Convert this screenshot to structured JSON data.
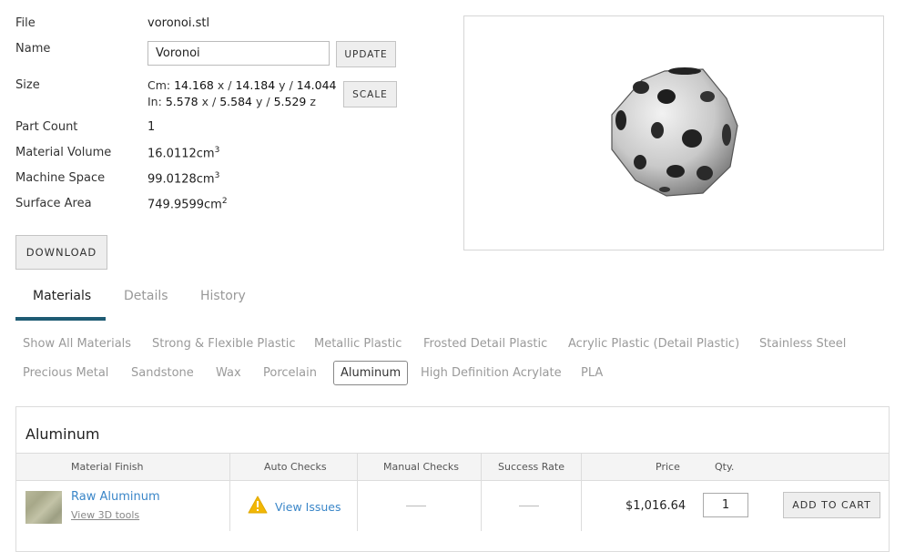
{
  "file": {
    "label": "File",
    "value": "voronoi.stl"
  },
  "name": {
    "label": "Name",
    "value": "Voronoi",
    "update_label": "UPDATE"
  },
  "size": {
    "label": "Size",
    "cm_prefix": "Cm:",
    "cm_x": "14.168",
    "cm_y": "14.184",
    "cm_z": "14.044",
    "in_prefix": "In:",
    "in_x": "5.578",
    "in_y": "5.584",
    "in_z": "5.529",
    "x_unit": "x",
    "y_unit": "y",
    "z_unit": "z",
    "sep": "/",
    "scale_label": "SCALE"
  },
  "part_count": {
    "label": "Part Count",
    "value": "1"
  },
  "material_volume": {
    "label": "Material Volume",
    "value": "16.0112cm",
    "exp": "3"
  },
  "machine_space": {
    "label": "Machine Space",
    "value": "99.0128cm",
    "exp": "3"
  },
  "surface_area": {
    "label": "Surface Area",
    "value": "749.9599cm",
    "exp": "2"
  },
  "download_label": "DOWNLOAD",
  "tabs": [
    {
      "label": "Materials",
      "active": true
    },
    {
      "label": "Details",
      "active": false
    },
    {
      "label": "History",
      "active": false
    }
  ],
  "material_filters": [
    "Show All Materials",
    "Strong & Flexible Plastic",
    "Metallic Plastic",
    "Frosted Detail Plastic",
    "Acrylic Plastic (Detail Plastic)",
    "Stainless Steel",
    "Precious Metal",
    "Sandstone",
    "Wax",
    "Porcelain",
    "Aluminum",
    "High Definition Acrylate",
    "PLA"
  ],
  "active_filter": "Aluminum",
  "panel": {
    "title": "Aluminum",
    "columns": [
      "Material Finish",
      "Auto Checks",
      "Manual Checks",
      "Success Rate",
      "Price",
      "Qty."
    ],
    "row": {
      "finish": "Raw Aluminum",
      "tools_link": "View 3D tools",
      "auto_checks": "View Issues",
      "price": "$1,016.64",
      "qty": "1",
      "add_to_cart": "ADD TO CART"
    }
  },
  "colors": {
    "accent": "#1e5b73",
    "link": "#3a86c8",
    "warning": "#f2b705"
  }
}
